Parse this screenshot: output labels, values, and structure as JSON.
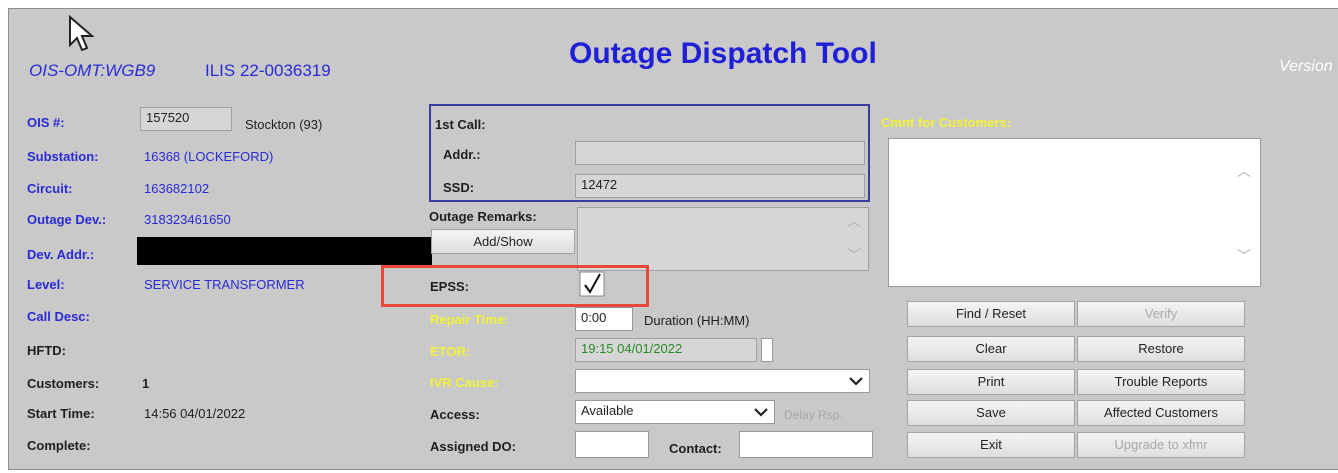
{
  "header": {
    "left_id": "OIS-OMT:WGB9",
    "ilis": "ILIS 22-0036319",
    "title": "Outage Dispatch Tool",
    "version_label": "Version"
  },
  "left": {
    "ois_label": "OIS #:",
    "ois_value": "157520",
    "ois_location": "Stockton (93)",
    "substation_label": "Substation:",
    "substation_value": "16368 (LOCKEFORD)",
    "circuit_label": "Circuit:",
    "circuit_value": "163682102",
    "outage_dev_label": "Outage Dev.:",
    "outage_dev_value": "318323461650",
    "dev_addr_label": "Dev. Addr.:",
    "level_label": "Level:",
    "level_value": "SERVICE TRANSFORMER",
    "call_desc_label": "Call Desc:",
    "hftd_label": "HFTD:",
    "customers_label": "Customers:",
    "customers_value": "1",
    "start_time_label": "Start Time:",
    "start_time_value": "14:56 04/01/2022",
    "complete_label": "Complete:"
  },
  "middle": {
    "first_call_label": "1st Call:",
    "addr_label": "Addr.:",
    "addr_value": "",
    "ssd_label": "SSD:",
    "ssd_value": "12472",
    "outage_remarks_label": "Outage Remarks:",
    "add_show_button": "Add/Show",
    "epss_label": "EPSS:",
    "epss_checked": true,
    "repair_time_label": "Repair Time:",
    "repair_time_value": "0:00",
    "duration_label": "Duration (HH:MM)",
    "etor_label": "ETOR:",
    "etor_value": "19:15 04/01/2022",
    "ivr_cause_label": "IVR Cause:",
    "ivr_cause_value": "",
    "access_label": "Access:",
    "access_value": "Available",
    "delay_rsp_label": "Delay Rsp.",
    "assigned_do_label": "Assigned DO:",
    "assigned_do_value": "",
    "contact_label": "Contact:",
    "contact_value": ""
  },
  "right": {
    "cmnt_label": "Cmnt for Customers:",
    "cmnt_value": ""
  },
  "buttons": {
    "find_reset": "Find / Reset",
    "verify": "Verify",
    "clear": "Clear",
    "restore": "Restore",
    "print": "Print",
    "trouble_reports": "Trouble Reports",
    "save": "Save",
    "affected_customers": "Affected Customers",
    "exit": "Exit",
    "upgrade_xfmr": "Upgrade to xfmr"
  },
  "colors": {
    "panel_bg": "#c9c9c9",
    "label_blue": "#2a2ad6",
    "label_yellow": "#f2f23a",
    "etor_green": "#2a8a2a",
    "highlight_red": "#e8483a",
    "first_call_border": "#3c3c9e"
  },
  "icons": {
    "cursor": "mouse-pointer-icon",
    "epss_check": "checkmark-icon",
    "dropdown": "chevron-down-icon",
    "scroll_up": "scroll-up-arrow-icon",
    "scroll_down": "scroll-down-arrow-icon"
  }
}
